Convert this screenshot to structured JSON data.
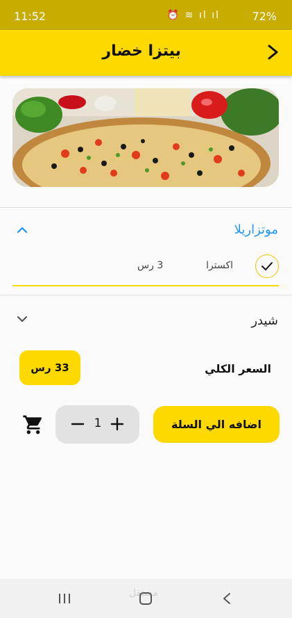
{
  "status_bar": {
    "time": "11:52",
    "battery": "72%",
    "icons": "⏰ ≋ ıl ıl"
  },
  "app_bar": {
    "title": "بيتزا خضار",
    "back_icon": "chevron-right-icon"
  },
  "hero": {
    "image": "vegetable-pizza-photo"
  },
  "section_mozzarella": {
    "title": "موتزاريلا",
    "title_color": "#2196f3",
    "expanded": true
  },
  "option": {
    "name": "اكسترا",
    "price": "3 رس",
    "checked": true
  },
  "section_cheddar": {
    "title": "شيدر",
    "expanded": false
  },
  "total": {
    "label": "السعر الكلي",
    "value": "33 رس"
  },
  "actions": {
    "add_to_cart": "اضافه الي السلة",
    "quantity": "1",
    "cart_icon": "shopping-cart-icon"
  },
  "nav": {
    "recent": "recent-apps-icon",
    "home": "home-icon",
    "back": "back-icon",
    "watermark": "مستقل"
  },
  "colors": {
    "accent": "#fdd900",
    "status_bar": "#c9ac00",
    "link": "#2196f3"
  }
}
